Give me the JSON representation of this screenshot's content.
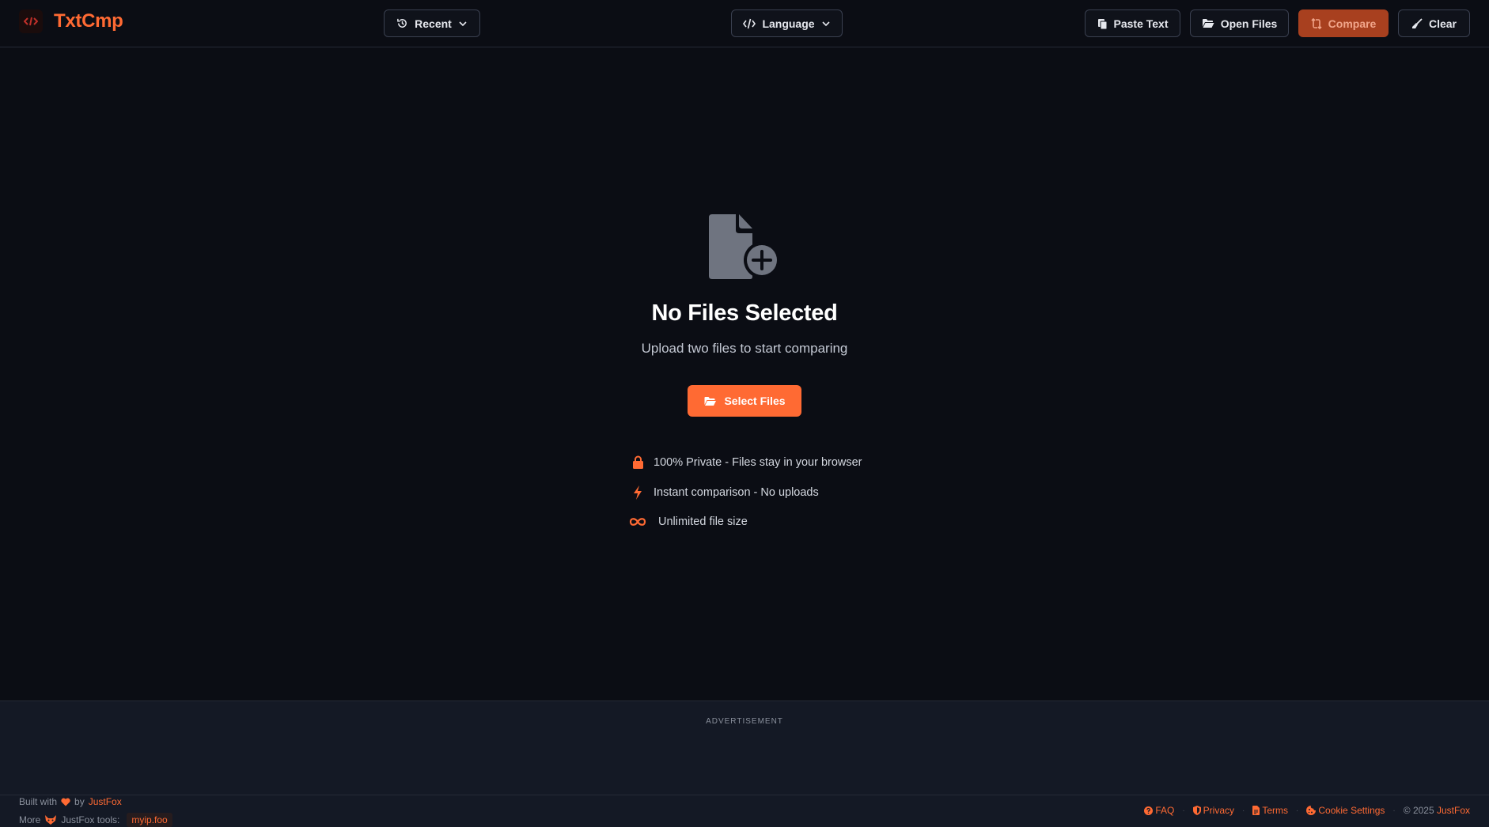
{
  "app": {
    "name": "TxtCmp"
  },
  "header": {
    "recent_label": "Recent",
    "language_label": "Language",
    "paste_label": "Paste Text",
    "open_label": "Open Files",
    "compare_label": "Compare",
    "clear_label": "Clear"
  },
  "main": {
    "title": "No Files Selected",
    "subtitle": "Upload two files to start comparing",
    "select_label": "Select Files",
    "features": [
      {
        "icon": "lock-icon",
        "text": "100% Private - Files stay in your browser"
      },
      {
        "icon": "bolt-icon",
        "text": "Instant comparison - No uploads"
      },
      {
        "icon": "infinity-icon",
        "text": "Unlimited file size"
      }
    ]
  },
  "ad": {
    "label": "ADVERTISEMENT"
  },
  "footer": {
    "built_with": "Built with",
    "by": "by",
    "author": "JustFox",
    "more": "More",
    "tools_label": "JustFox tools:",
    "tool_link": "myip.foo",
    "links": {
      "faq": "FAQ",
      "privacy": "Privacy",
      "terms": "Terms",
      "cookies": "Cookie Settings"
    },
    "copyright": "© 2025",
    "copyright_owner": "JustFox"
  },
  "colors": {
    "accent": "#ff6a33",
    "background": "#0b0d14",
    "panel": "#141925"
  }
}
